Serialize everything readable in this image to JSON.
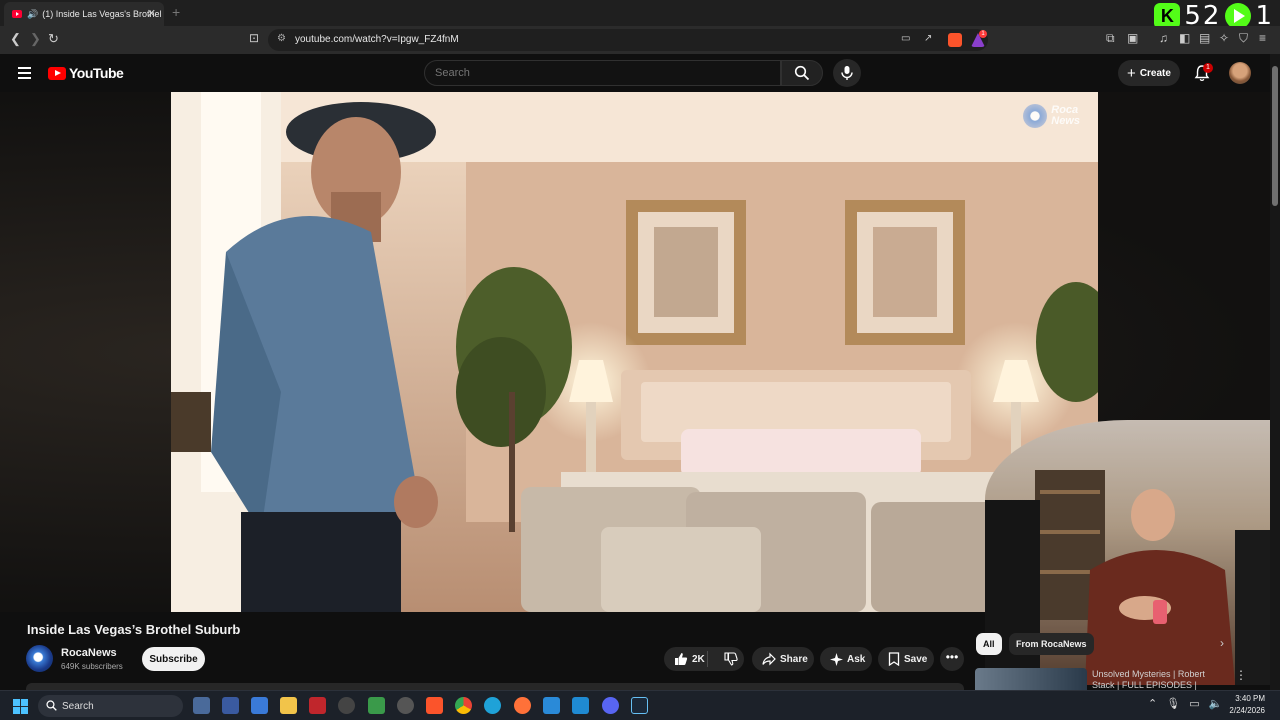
{
  "browser": {
    "tab_title": "(1) Inside Las Vegas's Brothel",
    "tab_close": "✕",
    "new_tab": "+",
    "url": "youtube.com/watch?v=Ipgw_FZ4fnM",
    "shield_badge": "1"
  },
  "stream_overlay": {
    "kick_letter": "K",
    "count_a": "52",
    "count_b": "1"
  },
  "youtube": {
    "logo_text": "YouTube",
    "search_placeholder": "Search",
    "create_label": "Create",
    "notification_count": "1",
    "watermark_line1": "Roca",
    "watermark_line2": "News"
  },
  "video": {
    "title": "Inside Las Vegas’s Brothel Suburb",
    "channel_name": "RocaNews",
    "subscribers": "649K subscribers",
    "subscribe_label": "Subscribe",
    "like_count": "2K",
    "share_label": "Share",
    "ask_label": "Ask",
    "save_label": "Save",
    "more_label": "•••"
  },
  "sidebar": {
    "chips": [
      "All",
      "From RocaNews"
    ],
    "next_chip": "›",
    "recommendation_title": "Unsolved Mysteries | Robert Stack | FULL EPISODES |",
    "menu_label": "⋮"
  },
  "taskbar": {
    "search_label": "Search",
    "time": "3:40 PM",
    "date": "2/24/2026"
  },
  "colors": {
    "youtube_red": "#ff0000",
    "kick_green": "#53fc18",
    "page_bg": "#0f0f0f"
  }
}
